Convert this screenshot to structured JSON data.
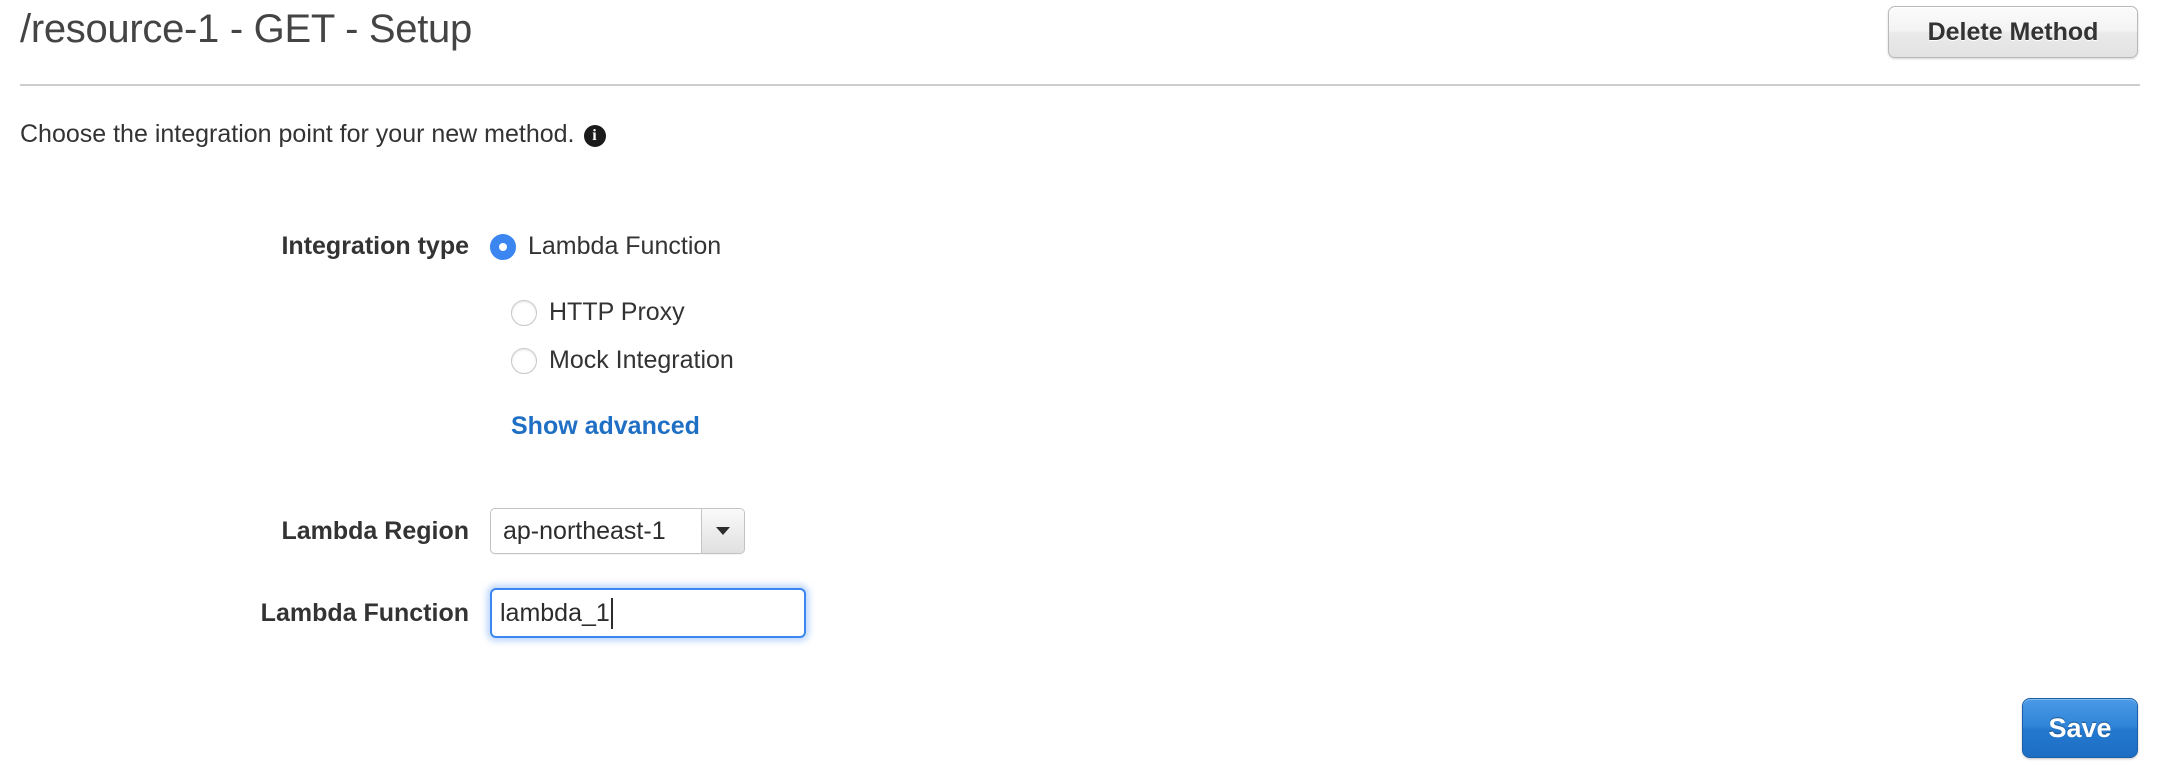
{
  "header": {
    "title": "/resource-1 - GET - Setup",
    "delete_method_label": "Delete Method"
  },
  "intro": {
    "text": "Choose the integration point for your new method.",
    "info_icon": "info-icon",
    "info_glyph": "i"
  },
  "form": {
    "integration_type": {
      "label": "Integration type",
      "options": [
        {
          "label": "Lambda Function",
          "selected": true
        },
        {
          "label": "HTTP Proxy",
          "selected": false
        },
        {
          "label": "Mock Integration",
          "selected": false
        }
      ]
    },
    "show_advanced_label": "Show advanced",
    "lambda_region": {
      "label": "Lambda Region",
      "value": "ap-northeast-1",
      "arrow_icon": "chevron-down-icon"
    },
    "lambda_function": {
      "label": "Lambda Function",
      "value": "lambda_1",
      "placeholder": ""
    }
  },
  "footer": {
    "save_label": "Save"
  },
  "colors": {
    "accent_blue": "#3b86f0",
    "link_blue": "#1f6fc4",
    "save_button_blue": "#2479cf",
    "text": "#333333",
    "rule": "#cdcdcd"
  }
}
